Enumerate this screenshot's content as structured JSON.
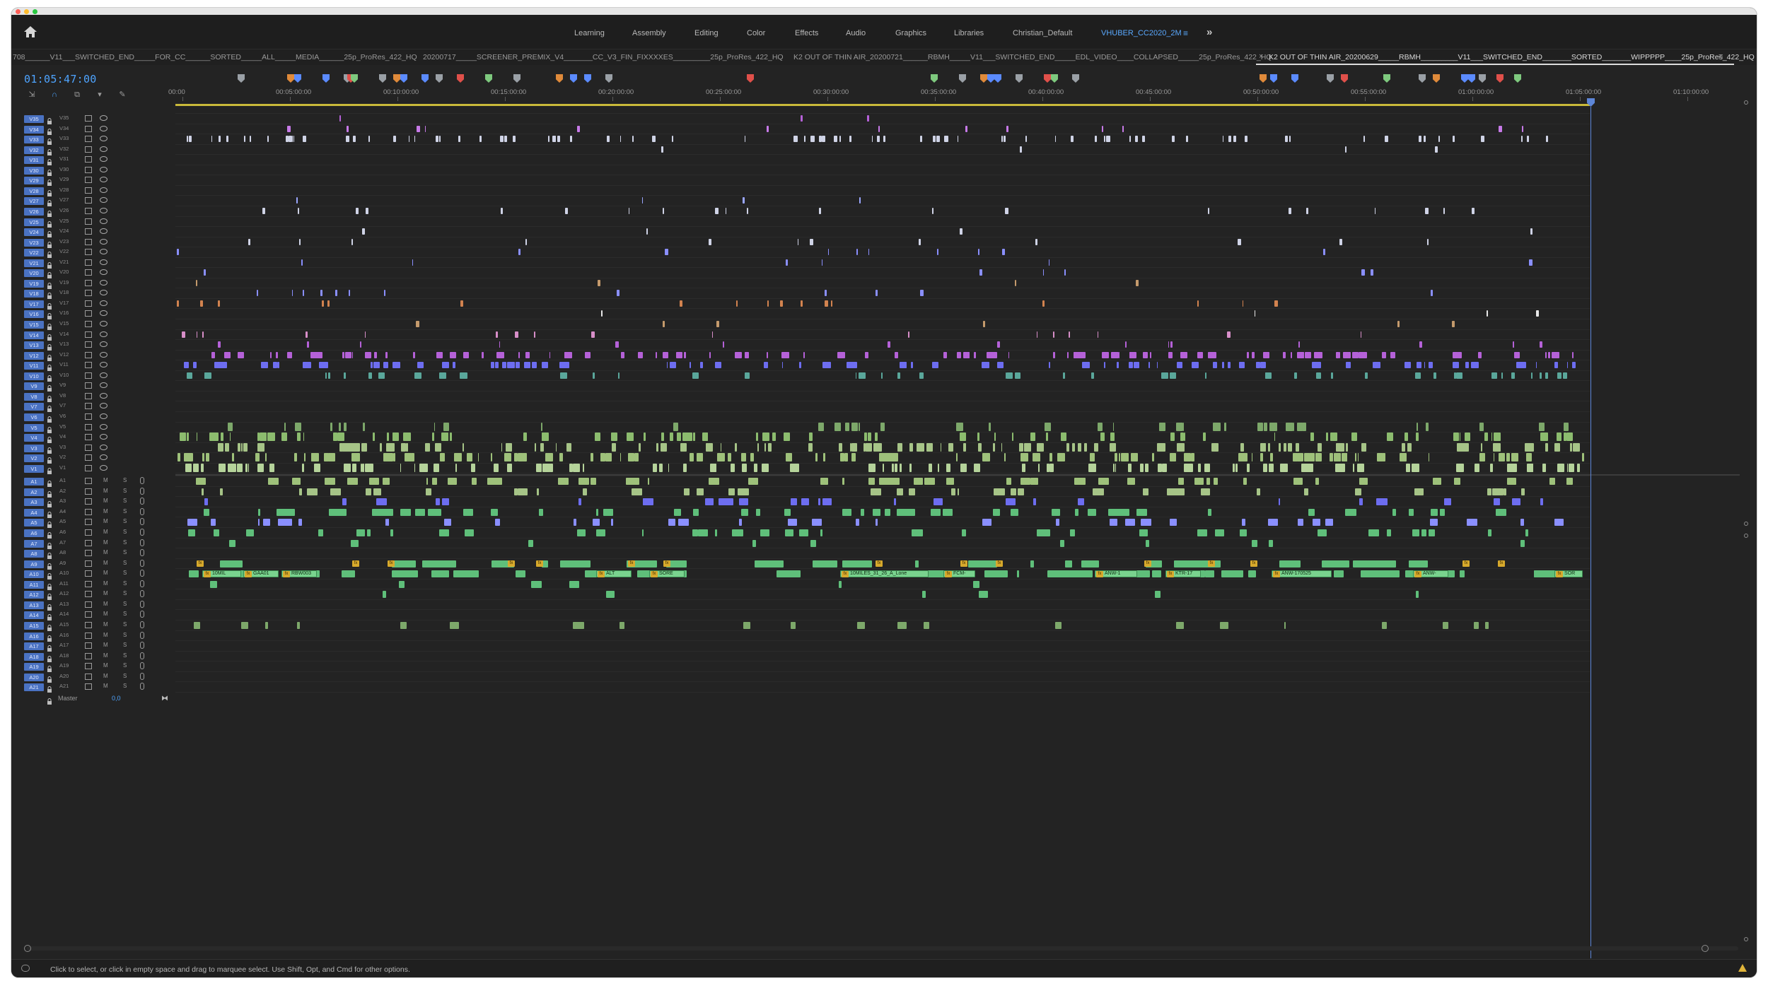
{
  "workspaces": {
    "items": [
      "Learning",
      "Assembly",
      "Editing",
      "Color",
      "Effects",
      "Audio",
      "Graphics",
      "Libraries",
      "Christian_Default",
      "VHUBER_CC2020_2M"
    ],
    "active": "VHUBER_CC2020_2M"
  },
  "sequence_tabs": [
    "708______V11___SWITCHED_END_____FOR_CC______SORTED_____ALL_____MEDIA______25p_ProRes_422_HQ",
    "20200717_____SCREENER_PREMIX_V4_______CC_V3_FIN_FIXXXXES_________25p_ProRes_422_HQ",
    "K2 OUT OF THIN AIR_20200721______RBMH_____V11___SWITCHED_END_____EDL_VIDEO____COLLAPSED_____25p_ProRes_422_HQ",
    "K2 OUT OF THIN AIR_20200629_____RBMH_________V11___SWITCHED_END_______SORTED_______WIPPPPP____25p_ProRes_422_HQ"
  ],
  "timecode": "01:05:47:00",
  "ruler_ticks": [
    "00:00",
    "00:05:00:00",
    "00:10:00:00",
    "00:15:00:00",
    "00:20:00:00",
    "00:25:00:00",
    "00:30:00:00",
    "00:35:00:00",
    "00:40:00:00",
    "00:45:00:00",
    "00:50:00:00",
    "00:55:00:00",
    "01:00:00:00",
    "01:05:00:00",
    "01:10:00:00"
  ],
  "video_tracks": [
    "V35",
    "V34",
    "V33",
    "V32",
    "V31",
    "V30",
    "V29",
    "V28",
    "V27",
    "V26",
    "V25",
    "V24",
    "V23",
    "V22",
    "V21",
    "V20",
    "V19",
    "V18",
    "V17",
    "V16",
    "V15",
    "V14",
    "V13",
    "V12",
    "V11",
    "V10",
    "V9",
    "V8",
    "V7",
    "V6",
    "V5",
    "V4",
    "V3",
    "V2",
    "V1"
  ],
  "audio_tracks": [
    "A1",
    "A2",
    "A3",
    "A4",
    "A5",
    "A6",
    "A7",
    "A8",
    "A9",
    "A10",
    "A11",
    "A12",
    "A13",
    "A14",
    "A15",
    "A16",
    "A17",
    "A18",
    "A19",
    "A20",
    "A21"
  ],
  "audio_buttons": {
    "mute": "M",
    "solo": "S"
  },
  "master": {
    "label": "Master",
    "value": "0,0"
  },
  "audio_clip_labels": [
    "10MIL",
    "GAA01",
    "RBW003",
    "ALT",
    "SORE",
    "10MILES_31_26_A_Lone",
    "FCM-",
    "ANW-1",
    "KTR-17",
    "ANW-170525",
    "ANW-",
    "SOR"
  ],
  "status_text": "Click to select, or click in empty space and drag to marquee select. Use Shift, Opt, and Cmd for other options.",
  "colors": {
    "accent": "#4ea4ff",
    "track_header": "#4a72c2",
    "clip_audio": "#5fbf7a",
    "clip_purple": "#b561d8",
    "clip_blue": "#6d6df0",
    "clip_teal": "#5aa79b"
  }
}
